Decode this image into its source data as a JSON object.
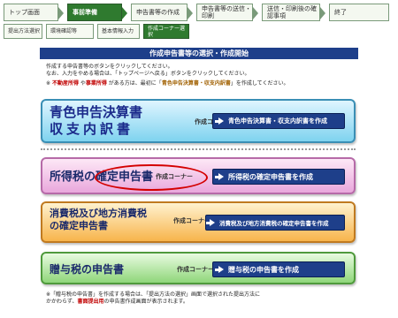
{
  "steps": {
    "items": [
      {
        "label": "トップ画面"
      },
      {
        "label": "事前準備"
      },
      {
        "label": "申告書等の作成"
      },
      {
        "label": "申告書等の送信・印刷"
      },
      {
        "label": "送信・印刷後の確認事項"
      },
      {
        "label": "終了"
      }
    ]
  },
  "substeps": {
    "items": [
      {
        "label": "提出方法選択"
      },
      {
        "label": "環境確認等"
      },
      {
        "label": "基本情報入力"
      },
      {
        "label": "作成コーナー選択"
      }
    ]
  },
  "header": {
    "title": "作成申告書等の選択・作成開始"
  },
  "intro": {
    "line1": "作成する申告書等のボタンをクリックしてください。",
    "line2": "なお、入力をやめる場合は、「トップページへ戻る」ボタンをクリックしてください。",
    "note_prefix": "※ ",
    "note_red1": "不動産所得",
    "note_mid1": " や",
    "note_red2": "事業所得",
    "note_mid2": " がある方は、最初に「",
    "note_brown": "青色申告決算書・収支内訳書",
    "note_end": "」を作成してください。"
  },
  "cards": [
    {
      "title_line1": "青色申告決算書",
      "title_line2": "収支内訳書",
      "corner": "作成コーナー",
      "action": "青色申告決算書・収支内訳書を作成",
      "color": "#7fd3ef"
    },
    {
      "title": "所得税の確定申告書",
      "corner": "作成コーナー",
      "action": "所得税の確定申告書を作成",
      "color": "#e9a7dc"
    },
    {
      "title_line1": "消費税及び地方消費税",
      "title_line2": "の確定申告書",
      "corner": "作成コーナー",
      "action": "消費税及び地方消費税の確定申告書を作成",
      "color": "#f7b44b"
    },
    {
      "title": "贈与税の申告書",
      "corner": "作成コーナー",
      "action": "贈与税の申告書を作成",
      "color": "#8fd67a"
    }
  ],
  "footnote": {
    "line1": "※「贈与税の申告書」を作成する場合は、「提出方法の選択」画面で選択された提出方法に",
    "line2_pre": "かかわらず、",
    "line2_red": "書面提出用",
    "line2_post": "の申告書作成画面が表示されます。"
  }
}
